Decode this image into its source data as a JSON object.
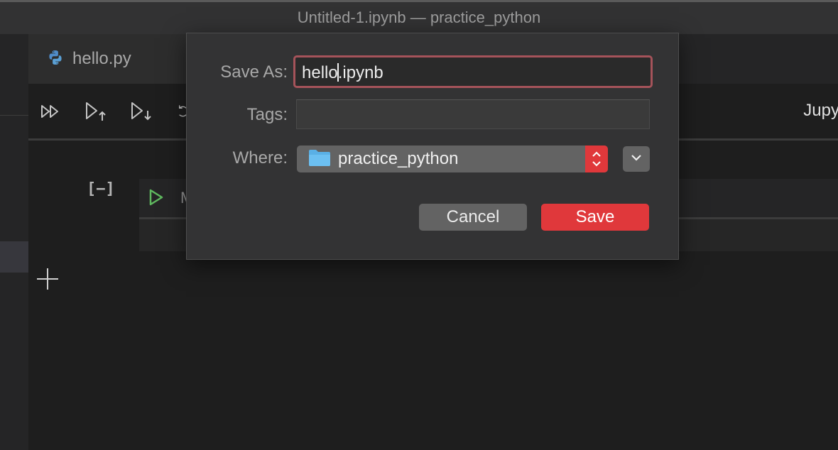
{
  "window": {
    "title": "Untitled-1.ipynb — practice_python"
  },
  "tabs": [
    {
      "label": "hello.py",
      "icon": "python-icon"
    }
  ],
  "toolbar": {
    "buttons": [
      {
        "name": "run-all-icon"
      },
      {
        "name": "run-above-icon"
      },
      {
        "name": "run-below-icon"
      },
      {
        "name": "undo-icon"
      }
    ],
    "kernel_label": "Jupy"
  },
  "notebook": {
    "execution_count": "[−]",
    "cell_language": "M"
  },
  "dialog": {
    "save_as_label": "Save As:",
    "filename_before_caret": "hello",
    "filename_after_caret": ".ipynb",
    "tags_label": "Tags:",
    "tags_value": "",
    "where_label": "Where:",
    "where_value": "practice_python",
    "cancel_label": "Cancel",
    "save_label": "Save"
  },
  "colors": {
    "accent": "#e0383b",
    "focus_ring": "#a5535a",
    "run_green": "#5fb85f",
    "folder_blue": "#5ab0e6"
  }
}
